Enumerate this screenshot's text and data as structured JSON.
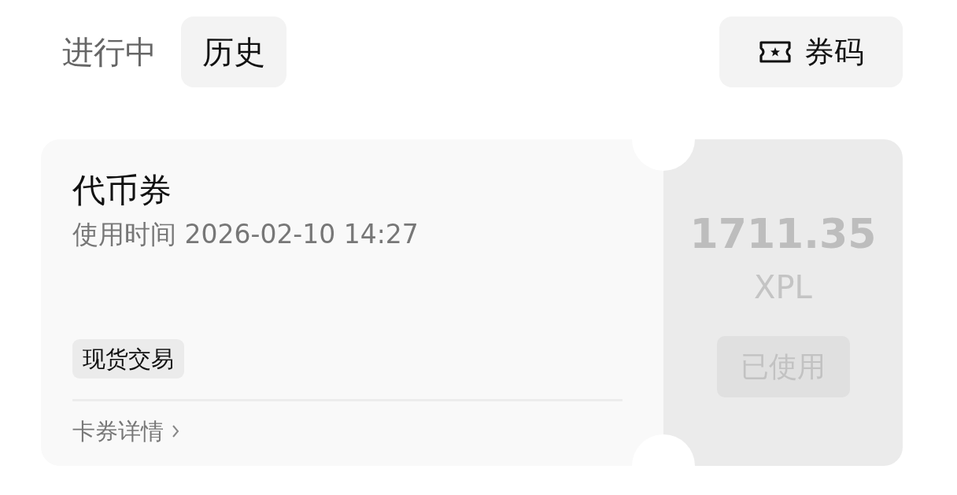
{
  "tabs": [
    {
      "label": "进行中",
      "selected": false
    },
    {
      "label": "历史",
      "selected": true
    }
  ],
  "code_button": {
    "label": "券码"
  },
  "coupon": {
    "title": "代币券",
    "used_time": "使用时间 2026-02-10 14:27",
    "tag": "现货交易",
    "details_link": "卡券详情",
    "amount": "1711.35",
    "currency": "XPL",
    "status_button": {
      "label": "已使用",
      "disabled": true
    }
  }
}
